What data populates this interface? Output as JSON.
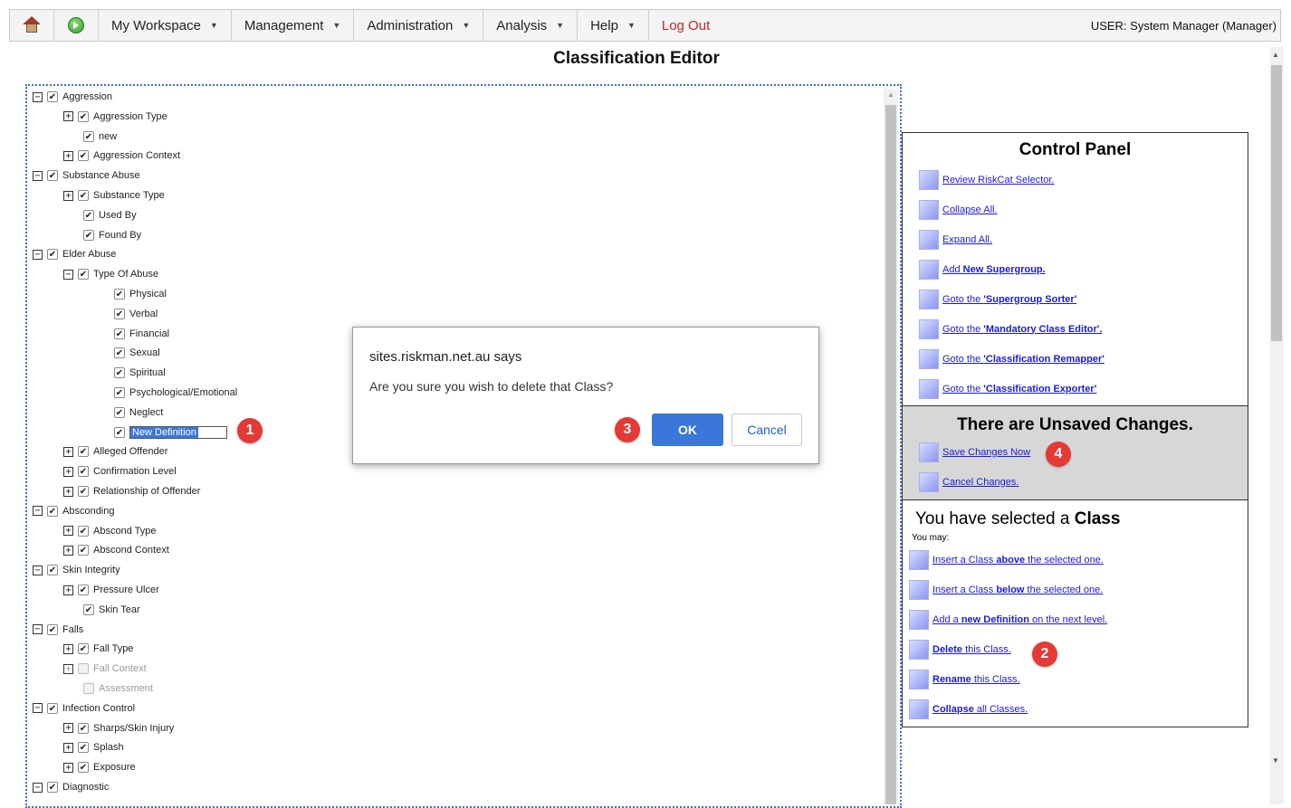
{
  "menu": {
    "items": [
      {
        "label": "My Workspace"
      },
      {
        "label": "Management"
      },
      {
        "label": "Administration"
      },
      {
        "label": "Analysis"
      },
      {
        "label": "Help"
      }
    ],
    "logout": "Log Out",
    "user": "USER: System Manager (Manager)"
  },
  "title": "Classification Editor",
  "tree": [
    {
      "label": "Aggression",
      "level": 0,
      "expander": "−",
      "checked": true
    },
    {
      "label": "Aggression Type",
      "level": 1,
      "expander": "+",
      "checked": true
    },
    {
      "label": "new",
      "level": 2,
      "checked": true
    },
    {
      "label": "Aggression Context",
      "level": 1,
      "expander": "+",
      "checked": true
    },
    {
      "label": "Substance Abuse",
      "level": 0,
      "expander": "−",
      "checked": true
    },
    {
      "label": "Substance Type",
      "level": 1,
      "expander": "+",
      "checked": true
    },
    {
      "label": "Used By",
      "level": 2,
      "checked": true
    },
    {
      "label": "Found By",
      "level": 2,
      "checked": true
    },
    {
      "label": "Elder Abuse",
      "level": 0,
      "expander": "−",
      "checked": true
    },
    {
      "label": "Type Of Abuse",
      "level": 1,
      "expander": "−",
      "checked": true
    },
    {
      "label": "Physical",
      "level": 3,
      "checked": true
    },
    {
      "label": "Verbal",
      "level": 3,
      "checked": true
    },
    {
      "label": "Financial",
      "level": 3,
      "checked": true
    },
    {
      "label": "Sexual",
      "level": 3,
      "checked": true
    },
    {
      "label": "Spiritual",
      "level": 3,
      "checked": true
    },
    {
      "label": "Psychological/Emotional",
      "level": 3,
      "checked": true
    },
    {
      "label": "Neglect",
      "level": 3,
      "checked": true
    },
    {
      "label": "New Definition",
      "level": 3,
      "checked": true,
      "editing": true
    },
    {
      "label": "Alleged Offender",
      "level": 1,
      "expander": "+",
      "checked": true
    },
    {
      "label": "Confirmation Level",
      "level": 1,
      "expander": "+",
      "checked": true
    },
    {
      "label": "Relationship of Offender",
      "level": 1,
      "expander": "+",
      "checked": true
    },
    {
      "label": "Absconding",
      "level": 0,
      "expander": "−",
      "checked": true
    },
    {
      "label": "Abscond Type",
      "level": 1,
      "expander": "+",
      "checked": true
    },
    {
      "label": "Abscond Context",
      "level": 1,
      "expander": "+",
      "checked": true
    },
    {
      "label": "Skin Integrity",
      "level": 0,
      "expander": "−",
      "checked": true
    },
    {
      "label": "Pressure Ulcer",
      "level": 1,
      "expander": "+",
      "checked": true
    },
    {
      "label": "Skin Tear",
      "level": 2,
      "checked": true
    },
    {
      "label": "Falls",
      "level": 0,
      "expander": "−",
      "checked": true
    },
    {
      "label": "Fall Type",
      "level": 1,
      "expander": "+",
      "checked": true
    },
    {
      "label": "Fall Context",
      "level": 1,
      "expander": "+",
      "checked": false,
      "disabled": true
    },
    {
      "label": "Assessment",
      "level": 2,
      "checked": false,
      "disabled": true
    },
    {
      "label": "Infection Control",
      "level": 0,
      "expander": "−",
      "checked": true
    },
    {
      "label": "Sharps/Skin Injury",
      "level": 1,
      "expander": "+",
      "checked": true
    },
    {
      "label": "Splash",
      "level": 1,
      "expander": "+",
      "checked": true
    },
    {
      "label": "Exposure",
      "level": 1,
      "expander": "+",
      "checked": true
    },
    {
      "label": "Diagnostic",
      "level": 0,
      "expander": "−",
      "checked": true
    }
  ],
  "control_panel": {
    "title": "Control Panel",
    "links": [
      {
        "pre": "Review RiskCat Selector.",
        "bold": "",
        "post": ""
      },
      {
        "pre": "Collapse All.",
        "bold": "",
        "post": ""
      },
      {
        "pre": "Expand All.",
        "bold": "",
        "post": ""
      },
      {
        "pre": "Add ",
        "bold": "New Supergroup.",
        "post": ""
      },
      {
        "pre": "Goto the ",
        "bold": "'Supergroup Sorter'",
        "post": ""
      },
      {
        "pre": "Goto the ",
        "bold": "'Mandatory Class Editor'.",
        "post": ""
      },
      {
        "pre": "Goto the ",
        "bold": "'Classification Remapper'",
        "post": ""
      },
      {
        "pre": "Goto the ",
        "bold": "'Classification Exporter'",
        "post": ""
      }
    ],
    "unsaved": {
      "title": "There are Unsaved Changes.",
      "save": "Save Changes Now",
      "cancel": "Cancel Changes."
    },
    "selected": {
      "title_pre": "You have selected a ",
      "title_bold": "Class",
      "sub": "You may:",
      "actions": [
        {
          "pre": "Insert a Class ",
          "bold": "above",
          "post": " the selected one."
        },
        {
          "pre": "Insert a Class ",
          "bold": "below",
          "post": " the selected one."
        },
        {
          "pre": "Add a ",
          "bold": "new Definition",
          "post": " on the next level."
        },
        {
          "pre": "",
          "bold": "Delete",
          "post": " this Class."
        },
        {
          "pre": "",
          "bold": "Rename",
          "post": " this Class."
        },
        {
          "pre": "",
          "bold": "Collapse",
          "post": " all Classes."
        }
      ]
    }
  },
  "dialog": {
    "origin": "sites.riskman.net.au says",
    "message": "Are you sure you wish to delete that Class?",
    "ok": "OK",
    "cancel": "Cancel"
  },
  "callouts": [
    "1",
    "2",
    "3",
    "4"
  ],
  "colors": {
    "accent": "#3a77d8",
    "callout": "#e53935",
    "logout": "#c0252b",
    "link": "#1a1adb"
  }
}
